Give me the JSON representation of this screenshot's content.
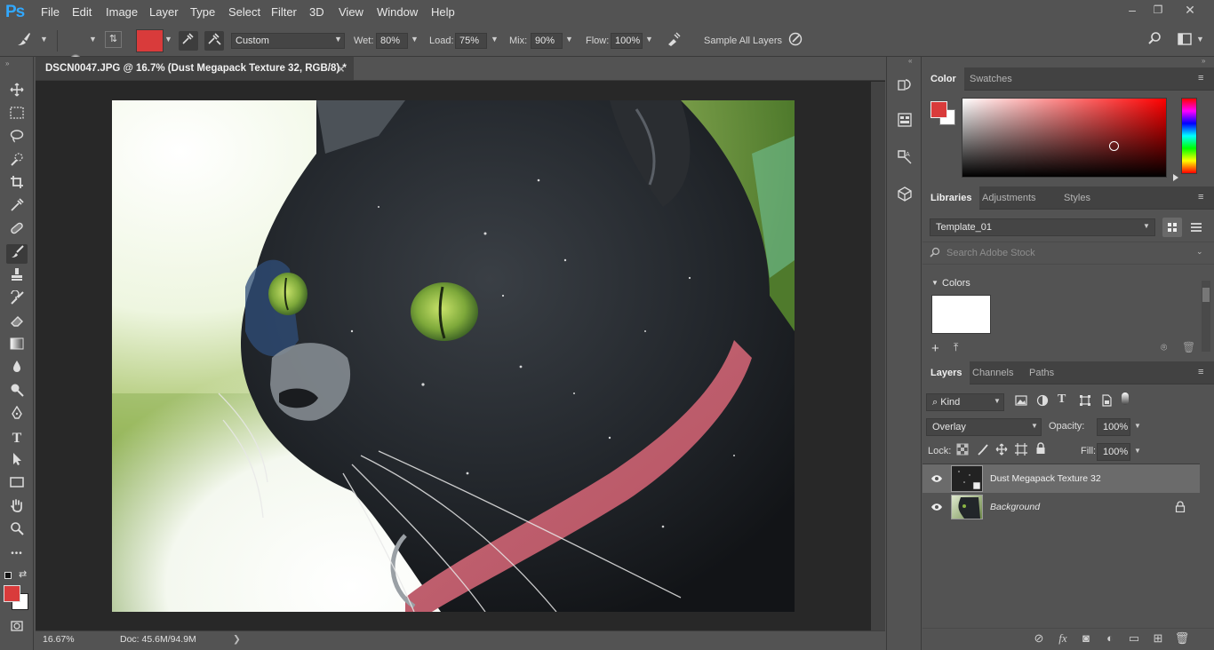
{
  "app": {
    "logo": "Ps",
    "menu": [
      "File",
      "Edit",
      "Image",
      "Layer",
      "Type",
      "Select",
      "Filter",
      "3D",
      "View",
      "Window",
      "Help"
    ],
    "window_controls": [
      "–",
      "❐",
      "✕"
    ]
  },
  "options_bar": {
    "brush_size": "13",
    "preset": "Custom",
    "wet_label": "Wet:",
    "wet_value": "80%",
    "load_label": "Load:",
    "load_value": "75%",
    "mix_label": "Mix:",
    "mix_value": "90%",
    "flow_label": "Flow:",
    "flow_value": "100%",
    "sample_all_layers": "Sample All Layers",
    "sample_all_layers_checked": false,
    "foreground_color": "#d93b3b"
  },
  "document": {
    "tab_title": "DSCN0047.JPG @ 16.7% (Dust Megapack Texture 32, RGB/8) *",
    "close_glyph": "×",
    "zoom": "16.67%",
    "doc_size": "Doc: 45.6M/94.9M",
    "status_arrow": "❯"
  },
  "tools": [
    "move-tool",
    "marquee-tool",
    "lasso-tool",
    "quick-selection-tool",
    "crop-tool",
    "eyedropper-tool",
    "healing-brush-tool",
    "brush-tool",
    "clone-stamp-tool",
    "history-brush-tool",
    "eraser-tool",
    "gradient-tool",
    "blur-tool",
    "dodge-tool",
    "pen-tool",
    "type-tool",
    "path-selection-tool",
    "rectangle-tool",
    "hand-tool",
    "zoom-tool",
    "more-tools"
  ],
  "tool_type_glyph": "T",
  "tool_more_glyph": "•••",
  "color_panel": {
    "tabs": [
      "Color",
      "Swatches"
    ],
    "foreground": "#d93b3b",
    "background": "#ffffff",
    "hue": "#ff0000"
  },
  "libraries_panel": {
    "tabs": [
      "Libraries",
      "Adjustments",
      "Styles"
    ],
    "library_name": "Template_01",
    "search_placeholder": "Search Adobe Stock",
    "section": "Colors",
    "swatch": "#ffffff"
  },
  "layers_panel": {
    "tabs": [
      "Layers",
      "Channels",
      "Paths"
    ],
    "filter_kind": "Kind",
    "blend_mode": "Overlay",
    "opacity_label": "Opacity:",
    "opacity_value": "100%",
    "lock_label": "Lock:",
    "fill_label": "Fill:",
    "fill_value": "100%",
    "layers": [
      {
        "name": "Dust Megapack Texture 32",
        "visible": true,
        "selected": true,
        "locked": false
      },
      {
        "name": "Background",
        "visible": true,
        "selected": false,
        "locked": true
      }
    ],
    "bottom_glyphs": [
      "⊘",
      "fx",
      "◙",
      "◐",
      "▭",
      "⊞",
      "🗑"
    ]
  }
}
